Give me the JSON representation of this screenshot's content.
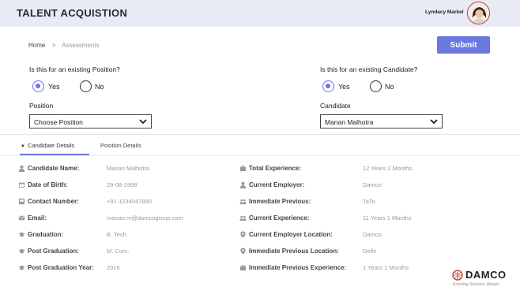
{
  "header": {
    "title": "TALENT ACQUISTION",
    "user_name": "Lyndacy Markel"
  },
  "breadcrumb": {
    "home": "Home",
    "separator": ">",
    "current": "Assessments"
  },
  "submit_label": "Submit",
  "position_section": {
    "question": "Is this for an existing Position?",
    "yes_label": "Yes",
    "no_label": "No",
    "selected": "Yes",
    "field_label": "Position",
    "select_value": "Choose Position"
  },
  "candidate_section": {
    "question": "Is this for an existing Candidate?",
    "yes_label": "Yes",
    "no_label": "No",
    "selected": "Yes",
    "field_label": "Candidate",
    "select_value": "Manan Malhotra"
  },
  "tabs": {
    "candidate_details": "Candidate Details",
    "position_details": "Position Details",
    "active": "Candidate Details"
  },
  "details_left": [
    {
      "label": "Candidate Name:",
      "value": "Manan Malhotra",
      "icon": "person-icon"
    },
    {
      "label": "Date of Birth:",
      "value": "29-08-1998",
      "icon": "calendar-icon"
    },
    {
      "label": "Contact Number:",
      "value": "+91-1234567890",
      "icon": "phone-icon"
    },
    {
      "label": "Email:",
      "value": "manan.m@damcogroup.com",
      "icon": "mail-icon"
    },
    {
      "label": "Graduation:",
      "value": "B. Tech",
      "icon": "graduation-cap-icon"
    },
    {
      "label": "Post  Graduation:",
      "value": "M. Com.",
      "icon": "graduation-cap-icon"
    },
    {
      "label": "Post Graduation Year:",
      "value": "2016",
      "icon": "graduation-cap-icon"
    }
  ],
  "details_right": [
    {
      "label": "Total Experience:",
      "value": "12 Years 2 Months",
      "icon": "briefcase-icon"
    },
    {
      "label": "Current Employer:",
      "value": "Damco",
      "icon": "person-icon"
    },
    {
      "label": "Immediate Previous:",
      "value": "TaTo",
      "icon": "group-icon"
    },
    {
      "label": "Current Experience:",
      "value": "11 Years 1 Months",
      "icon": "group-icon"
    },
    {
      "label": "Current Employer Location:",
      "value": "Damco",
      "icon": "location-pin-icon"
    },
    {
      "label": "Immediate Previous Location:",
      "value": "Delhi",
      "icon": "location-pin-icon"
    },
    {
      "label": "Immediate Previous Experience:",
      "value": "1 Years 1 Months",
      "icon": "briefcase-icon"
    }
  ],
  "logo": {
    "name": "DAMCO",
    "tagline": "Ensuring Success. Always"
  },
  "colors": {
    "accent": "#6a78e0",
    "topbar": "#e8eaf6"
  }
}
